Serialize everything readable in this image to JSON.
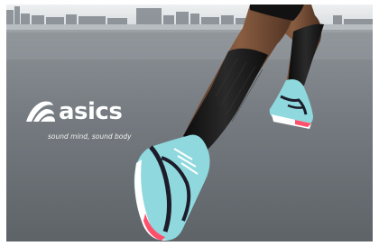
{
  "brand": {
    "name": "asics",
    "tagline": "sound mind, sound body"
  },
  "colors": {
    "sky": "#dfe3e6",
    "track": "#70767b",
    "shoe_primary": "#8fd8dd",
    "shoe_accent": "#1c1c2a",
    "shoe_highlight": "#ff4f6b",
    "sleeve": "#141414"
  }
}
